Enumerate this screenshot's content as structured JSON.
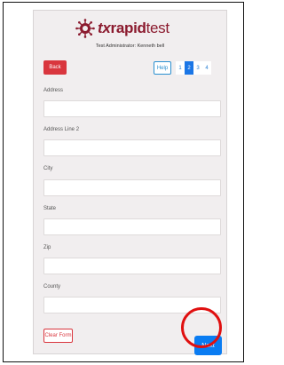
{
  "logo": {
    "tx": "tx",
    "rapid": "rapid",
    "test": "test"
  },
  "header": {
    "admin_text": "Test Administrator: Kenneth bell"
  },
  "toolbar": {
    "back_label": "Back",
    "help_label": "Help"
  },
  "pager": {
    "pages": [
      "1",
      "2",
      "3",
      "4"
    ],
    "active": "2"
  },
  "form": {
    "fields": [
      {
        "label": "Address",
        "value": ""
      },
      {
        "label": "Address Line 2",
        "value": ""
      },
      {
        "label": "City",
        "value": ""
      },
      {
        "label": "State",
        "value": ""
      },
      {
        "label": "Zip",
        "value": ""
      },
      {
        "label": "County",
        "value": ""
      }
    ]
  },
  "actions": {
    "clear_label": "Clear Form",
    "next_label": "Next"
  },
  "colors": {
    "brand": "#8b1a2e",
    "danger": "#d9363e",
    "primary": "#0a7cf2",
    "highlight": "#e01010"
  }
}
